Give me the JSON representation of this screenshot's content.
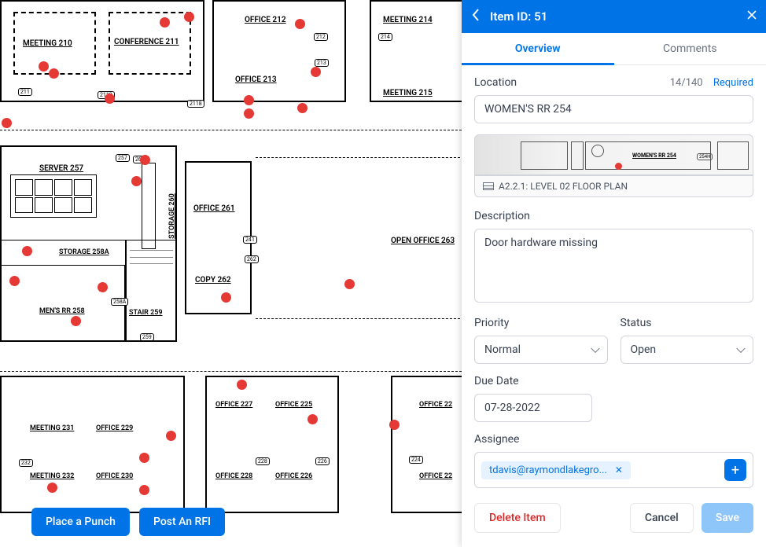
{
  "buttons": {
    "place_punch": "Place a Punch",
    "post_rfi": "Post An RFI"
  },
  "panel": {
    "title": "Item ID: 51",
    "tabs": {
      "overview": "Overview",
      "comments": "Comments"
    },
    "location": {
      "label": "Location",
      "counter": "14/140",
      "required": "Required",
      "value": "WOMEN'S RR 254"
    },
    "map_caption": "A2.2.1: LEVEL 02 FLOOR PLAN",
    "map_preview_label": "WOMEN'S RR   254",
    "description": {
      "label": "Description",
      "value": "Door hardware missing"
    },
    "priority": {
      "label": "Priority",
      "value": "Normal"
    },
    "status": {
      "label": "Status",
      "value": "Open"
    },
    "due_date": {
      "label": "Due Date",
      "value": "07-28-2022"
    },
    "assignee": {
      "label": "Assignee",
      "chip": "tdavis@raymondlakegro..."
    },
    "footer": {
      "delete": "Delete Item",
      "cancel": "Cancel",
      "save": "Save"
    }
  },
  "rooms": [
    {
      "label": "MEETING  210"
    },
    {
      "label": "CONFERENCE  211"
    },
    {
      "label": "OFFICE  212"
    },
    {
      "label": "OFFICE  213"
    },
    {
      "label": "MEETING  214"
    },
    {
      "label": "MEETING  215"
    },
    {
      "label": "SERVER  257"
    },
    {
      "label": "STORAGE  260"
    },
    {
      "label": "STORAGE  258A"
    },
    {
      "label": "OFFICE  261"
    },
    {
      "label": "OPEN OFFICE  263"
    },
    {
      "label": "COPY  262"
    },
    {
      "label": "MEN'S RR  258"
    },
    {
      "label": "STAIR  259"
    },
    {
      "label": "MEETING  231"
    },
    {
      "label": "OFFICE  229"
    },
    {
      "label": "OFFICE  227"
    },
    {
      "label": "OFFICE  225"
    },
    {
      "label": "OFFICE  22"
    },
    {
      "label": "MEETING  232"
    },
    {
      "label": "OFFICE  230"
    },
    {
      "label": "OFFICE  228"
    },
    {
      "label": "OFFICE  226"
    },
    {
      "label": "OFFICE  22"
    }
  ],
  "mini_tag": "254H"
}
